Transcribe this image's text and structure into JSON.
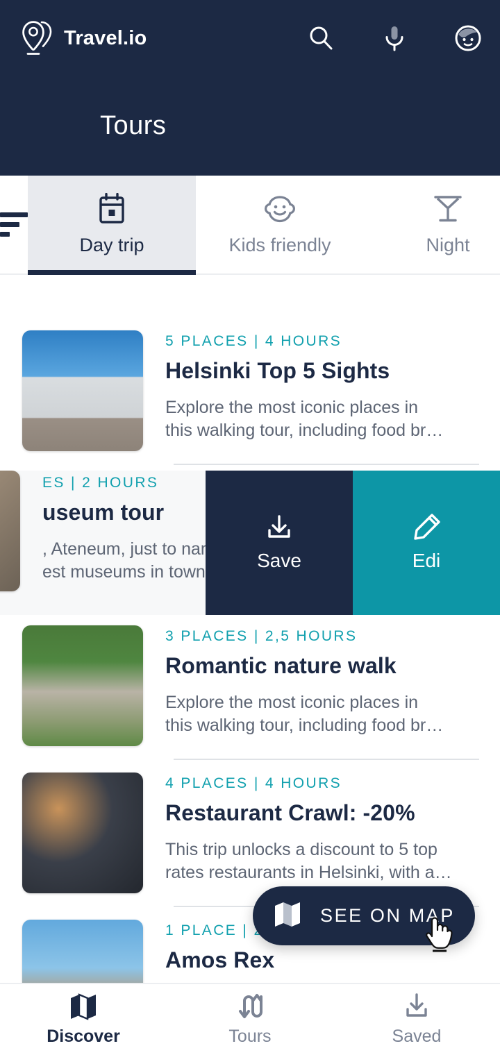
{
  "header": {
    "brand": "Travel.io",
    "logo_icon": "map-pin-logo-icon",
    "page_title": "Tours",
    "actions": [
      {
        "name": "search-icon",
        "label": "Search"
      },
      {
        "name": "microphone-icon",
        "label": "Voice search"
      },
      {
        "name": "avatar-icon",
        "label": "Profile"
      }
    ],
    "background_color": "#1c2944"
  },
  "tabs": {
    "filter_icon": "filter-sort-icon",
    "items": [
      {
        "label": "Day trip",
        "icon": "calendar-icon",
        "active": true
      },
      {
        "label": "Kids friendly",
        "icon": "baby-face-icon",
        "active": false
      },
      {
        "label": "Night",
        "icon": "cocktail-glass-icon",
        "active": false
      }
    ]
  },
  "tours": [
    {
      "meta": "5 PLACES | 4 HOURS",
      "title": "Helsinki Top 5 Sights",
      "description_line1": "Explore the most iconic places in",
      "description_line2": "this walking tour, including food br…",
      "thumbnail": "helsinki-cathedral-photo"
    },
    {
      "meta": "ES | 2 HOURS",
      "title": "useum tour",
      "description_line1": ", Ateneum, just to name a",
      "description_line2": "est museums in town with…",
      "thumbnail": "museum-photo",
      "swiped": true
    },
    {
      "meta": "3 PLACES | 2,5 HOURS",
      "title": "Romantic nature walk",
      "description_line1": "Explore the most iconic places in",
      "description_line2": "this walking tour, including food br…",
      "thumbnail": "esplanadi-park-photo"
    },
    {
      "meta": "4 PLACES | 4 HOURS",
      "title": "Restaurant Crawl: -20%",
      "description_line1": "This trip unlocks a discount to 5 top",
      "description_line2": "rates restaurants in Helsinki, with a…",
      "thumbnail": "restaurant-food-photo"
    },
    {
      "meta": "1 PLACE | 2",
      "title": "Amos Rex",
      "description_line1": "",
      "description_line2": "",
      "thumbnail": "amos-rex-photo"
    }
  ],
  "swipe_actions": {
    "save": {
      "label": "Save",
      "icon": "download-icon",
      "color": "#1c2944"
    },
    "edit": {
      "label": "Edi",
      "icon": "pencil-icon",
      "color": "#0d96a6"
    }
  },
  "fab": {
    "label": "SEE ON MAP",
    "icon": "map-folded-icon",
    "color": "#1c2944",
    "cursor": "hand-pointer-cursor"
  },
  "bottom_nav": [
    {
      "label": "Discover",
      "icon": "map-folded-icon",
      "active": true
    },
    {
      "label": "Tours",
      "icon": "route-arrows-icon",
      "active": false
    },
    {
      "label": "Saved",
      "icon": "download-icon",
      "active": false
    }
  ],
  "colors": {
    "navy": "#1c2944",
    "teal": "#11a0ae",
    "teal_dark": "#0d96a6",
    "muted": "#7b8394",
    "body_text": "#5d6574"
  }
}
